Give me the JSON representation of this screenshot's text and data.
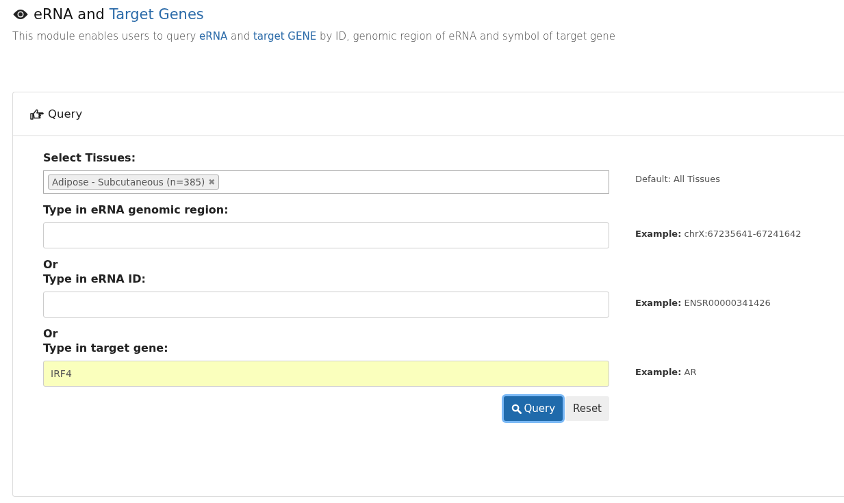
{
  "header": {
    "title_plain": "eRNA and",
    "title_link": "Target Genes",
    "description": "This module enables users to query **eRNA** and **target GENE** by ID, genomic region of eRNA and symbol of target gene"
  },
  "panel": {
    "title": "Query"
  },
  "tissues": {
    "label": "Select Tissues:",
    "tags": [
      {
        "text": "Adipose - Subcutaneous (n=385)",
        "remove": "✖"
      }
    ],
    "hint": "Default: All Tissues"
  },
  "fields": [
    {
      "label": "Type in eRNA genomic region:",
      "autofilled": false,
      "hint": "**Example:** chrX:67235641-67241642"
    },
    {
      "prefix": "Or",
      "label": "Type in eRNA ID:",
      "autofilled": false,
      "hint": "**Example:** ENSR00000341426"
    },
    {
      "prefix": "Or",
      "label": "Type in target gene:",
      "value": "IRF4",
      "autofilled": true,
      "hint": "**Example:** AR"
    }
  ],
  "buttons": [
    {
      "kind": "primary",
      "label": "Query",
      "focused": true
    },
    {
      "kind": "default",
      "label": "Reset",
      "focused": false
    }
  ]
}
